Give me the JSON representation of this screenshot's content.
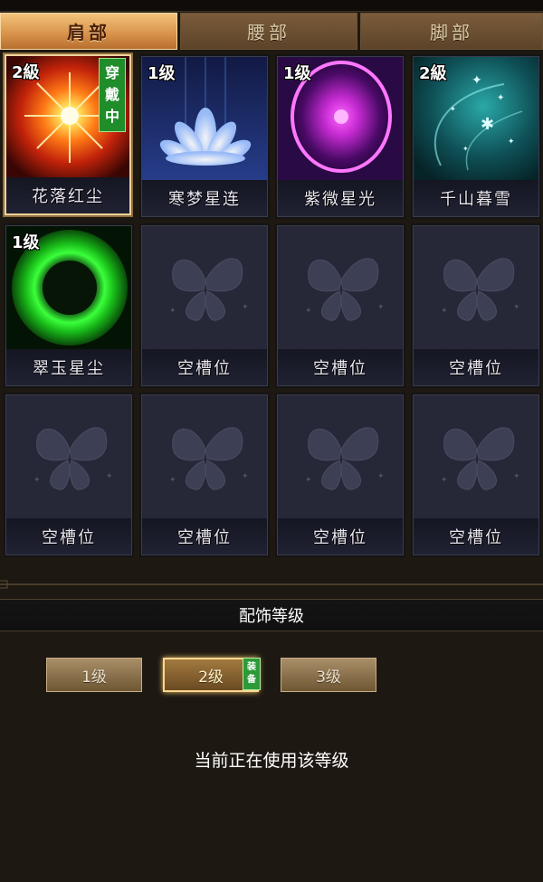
{
  "tabs": [
    {
      "label": "肩部",
      "active": true
    },
    {
      "label": "腰部",
      "active": false
    },
    {
      "label": "脚部",
      "active": false
    }
  ],
  "slots": [
    {
      "level": "2級",
      "name": "花落红尘",
      "wearing": true,
      "art": "red-burst-icon"
    },
    {
      "level": "1级",
      "name": "寒梦星连",
      "wearing": false,
      "art": "lotus-icon"
    },
    {
      "level": "1级",
      "name": "紫微星光",
      "wearing": false,
      "art": "purple-orb-icon"
    },
    {
      "level": "2級",
      "name": "千山暮雪",
      "wearing": false,
      "art": "snow-sparkle-icon"
    },
    {
      "level": "1级",
      "name": "翠玉星尘",
      "wearing": false,
      "art": "green-ring-icon"
    },
    {
      "level": "",
      "name": "空槽位",
      "wearing": false,
      "art": "butterfly-icon"
    },
    {
      "level": "",
      "name": "空槽位",
      "wearing": false,
      "art": "butterfly-icon"
    },
    {
      "level": "",
      "name": "空槽位",
      "wearing": false,
      "art": "butterfly-icon"
    },
    {
      "level": "",
      "name": "空槽位",
      "wearing": false,
      "art": "butterfly-icon"
    },
    {
      "level": "",
      "name": "空槽位",
      "wearing": false,
      "art": "butterfly-icon"
    },
    {
      "level": "",
      "name": "空槽位",
      "wearing": false,
      "art": "butterfly-icon"
    },
    {
      "level": "",
      "name": "空槽位",
      "wearing": false,
      "art": "butterfly-icon"
    }
  ],
  "wear_badge": "穿戴中",
  "section_title": "配饰等级",
  "level_buttons": [
    {
      "label": "1级",
      "selected": false
    },
    {
      "label": "2级",
      "selected": true
    },
    {
      "label": "3级",
      "selected": false
    }
  ],
  "equip_badge": "装备",
  "status_text": "当前正在使用该等级",
  "colors": {
    "tab_active": "#d9954d",
    "tab_inactive": "#6b4d31",
    "badge_green": "#1e8d2a",
    "selected_border": "#f0d29a"
  }
}
